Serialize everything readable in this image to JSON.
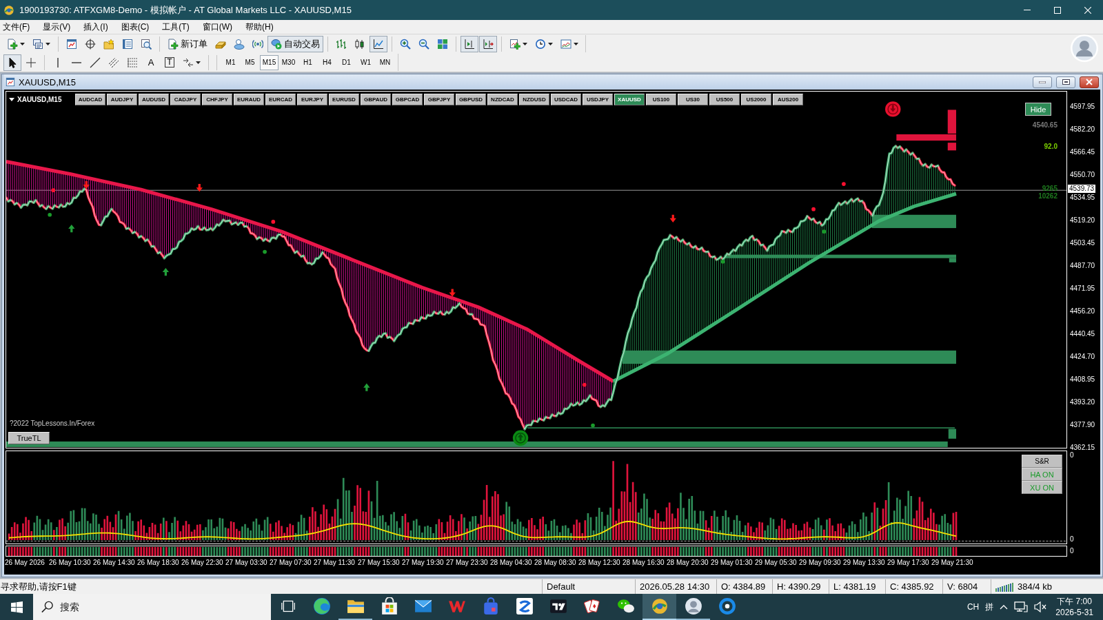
{
  "window": {
    "title": "1900193730: ATFXGM8-Demo - 模拟帐户 - AT Global Markets LLC - XAUUSD,M15"
  },
  "menu": [
    "文件(F)",
    "显示(V)",
    "插入(I)",
    "图表(C)",
    "工具(T)",
    "窗口(W)",
    "帮助(H)"
  ],
  "main_toolbar": [
    {
      "pressed": false
    },
    {
      "pressed": false
    },
    {
      "pressed": false
    },
    {
      "pressed": false
    },
    {
      "pressed": false
    },
    {
      "pressed": false
    },
    {
      "pressed": false
    },
    {
      "label": "新订单",
      "pressed": false
    },
    {
      "pressed": false
    },
    {
      "pressed": false
    },
    {
      "pressed": false
    },
    {
      "label": "自动交易",
      "pressed": true
    },
    {
      "pressed": false
    },
    {
      "pressed": false
    },
    {
      "pressed": true
    },
    {
      "pressed": false
    },
    {
      "pressed": false
    },
    {
      "pressed": false
    },
    {
      "pressed": true
    },
    {
      "pressed": true
    },
    {
      "pressed": false
    },
    {
      "pressed": false
    },
    {
      "pressed": false
    }
  ],
  "drawing_toolbar": [
    {
      "pressed": true
    },
    {
      "pressed": false
    },
    {
      "pressed": false
    },
    {
      "pressed": false
    },
    {
      "pressed": false
    },
    {
      "pressed": false
    },
    {
      "pressed": false
    },
    {
      "label": "A",
      "pressed": false
    },
    {
      "label": "T",
      "pressed": false
    },
    {
      "pressed": false
    }
  ],
  "periods": [
    {
      "label": "M1",
      "selected": false
    },
    {
      "label": "M5",
      "selected": false
    },
    {
      "label": "M15",
      "selected": true
    },
    {
      "label": "M30",
      "selected": false
    },
    {
      "label": "H1",
      "selected": false
    },
    {
      "label": "H4",
      "selected": false
    },
    {
      "label": "D1",
      "selected": false
    },
    {
      "label": "W1",
      "selected": false
    },
    {
      "label": "MN",
      "selected": false
    }
  ],
  "chart_window": {
    "title": "XAUUSD,M15",
    "symbol_label": "XAUUSD,M15",
    "symbol_buttons": [
      {
        "label": "AUDCAD",
        "selected": false
      },
      {
        "label": "AUDJPY",
        "selected": false
      },
      {
        "label": "AUDUSD",
        "selected": false
      },
      {
        "label": "CADJPY",
        "selected": false
      },
      {
        "label": "CHFJPY",
        "selected": false
      },
      {
        "label": "EURAUD",
        "selected": false
      },
      {
        "label": "EURCAD",
        "selected": false
      },
      {
        "label": "EURJPY",
        "selected": false
      },
      {
        "label": "EURUSD",
        "selected": false
      },
      {
        "label": "GBPAUD",
        "selected": false
      },
      {
        "label": "GBPCAD",
        "selected": false
      },
      {
        "label": "GBPJPY",
        "selected": false
      },
      {
        "label": "GBPUSD",
        "selected": false
      },
      {
        "label": "NZDCAD",
        "selected": false
      },
      {
        "label": "NZDUSD",
        "selected": false
      },
      {
        "label": "USDCAD",
        "selected": false
      },
      {
        "label": "USDJPY",
        "selected": false
      },
      {
        "label": "XAUUSD",
        "selected": true
      },
      {
        "label": "US100",
        "selected": false
      },
      {
        "label": "US30",
        "selected": false
      },
      {
        "label": "US500",
        "selected": false
      },
      {
        "label": "US2000",
        "selected": false
      },
      {
        "label": "AUS200",
        "selected": false
      }
    ],
    "hide_button": "Hide",
    "readouts": [
      {
        "text": "4540.65",
        "color": "#7a7a7a"
      },
      {
        "text": "92.0",
        "color": "#7cd000"
      },
      {
        "text": "9265",
        "color": "#1e7a1e"
      },
      {
        "text": "10262",
        "color": "#1e7a1e"
      }
    ],
    "copyright": "?2022 TopLessons.In/Forex",
    "trendline_button": "TrueTL",
    "price_axis": [
      "4597.95",
      "4582.20",
      "4566.45",
      "4550.70",
      "4534.95",
      "4519.20",
      "4503.45",
      "4487.70",
      "4471.95",
      "4456.20",
      "4440.45",
      "4424.70",
      "4408.95",
      "4393.20",
      "4377.90",
      "4362.15"
    ],
    "current_price": "4539.73",
    "indicator_buttons": [
      {
        "label": "S&R",
        "on": false
      },
      {
        "label": "HA ON",
        "on": true
      },
      {
        "label": "XU ON",
        "on": true
      }
    ],
    "indicator_axis": [
      "0",
      "0"
    ],
    "strip_axis": "0",
    "time_axis": [
      "26 May 2026",
      "26 May 10:30",
      "26 May 14:30",
      "26 May 18:30",
      "26 May 22:30",
      "27 May 03:30",
      "27 May 07:30",
      "27 May 11:30",
      "27 May 15:30",
      "27 May 19:30",
      "27 May 23:30",
      "28 May 04:30",
      "28 May 08:30",
      "28 May 12:30",
      "28 May 16:30",
      "28 May 20:30",
      "29 May 01:30",
      "29 May 05:30",
      "29 May 09:30",
      "29 May 13:30",
      "29 May 17:30",
      "29 May 21:30"
    ]
  },
  "status_bar": {
    "help": "寻求帮助,请按F1键",
    "fields": [
      "Default",
      "2026.05.28 14:30",
      "O: 4384.89",
      "H: 4390.29",
      "L: 4381.19",
      "C: 4385.92",
      "V: 6804"
    ],
    "traffic": "384/4 kb"
  },
  "taskbar": {
    "search": {
      "placeholder": "搜索"
    },
    "apps": [
      {
        "selected": false,
        "running": false
      },
      {
        "selected": false,
        "running": true
      },
      {
        "selected": false,
        "running": false
      },
      {
        "selected": false,
        "running": false
      },
      {
        "selected": false,
        "running": false
      },
      {
        "selected": false,
        "running": false
      },
      {
        "selected": false,
        "running": false
      },
      {
        "selected": false,
        "running": false
      },
      {
        "selected": false,
        "running": false
      },
      {
        "selected": false,
        "running": false
      },
      {
        "selected": true,
        "running": true
      },
      {
        "selected": false,
        "running": true
      },
      {
        "selected": false,
        "running": false
      }
    ],
    "tray": [
      "CH",
      "拼"
    ],
    "time": "下午 7:00",
    "date": "2026-5-31"
  }
}
